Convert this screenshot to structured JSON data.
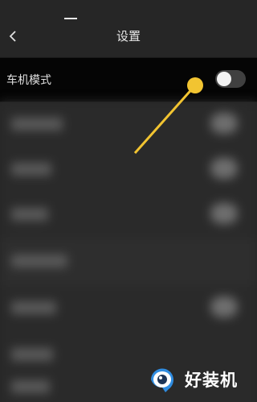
{
  "header": {
    "title": "设置"
  },
  "settings": {
    "car_mode_label": "车机模式",
    "car_mode_enabled": false
  },
  "watermark": {
    "text": "好装机"
  },
  "colors": {
    "annotation": "#f2c431",
    "background": "#262626",
    "highlight_row": "#050505"
  },
  "icons": {
    "back": "chevron-left-icon"
  }
}
